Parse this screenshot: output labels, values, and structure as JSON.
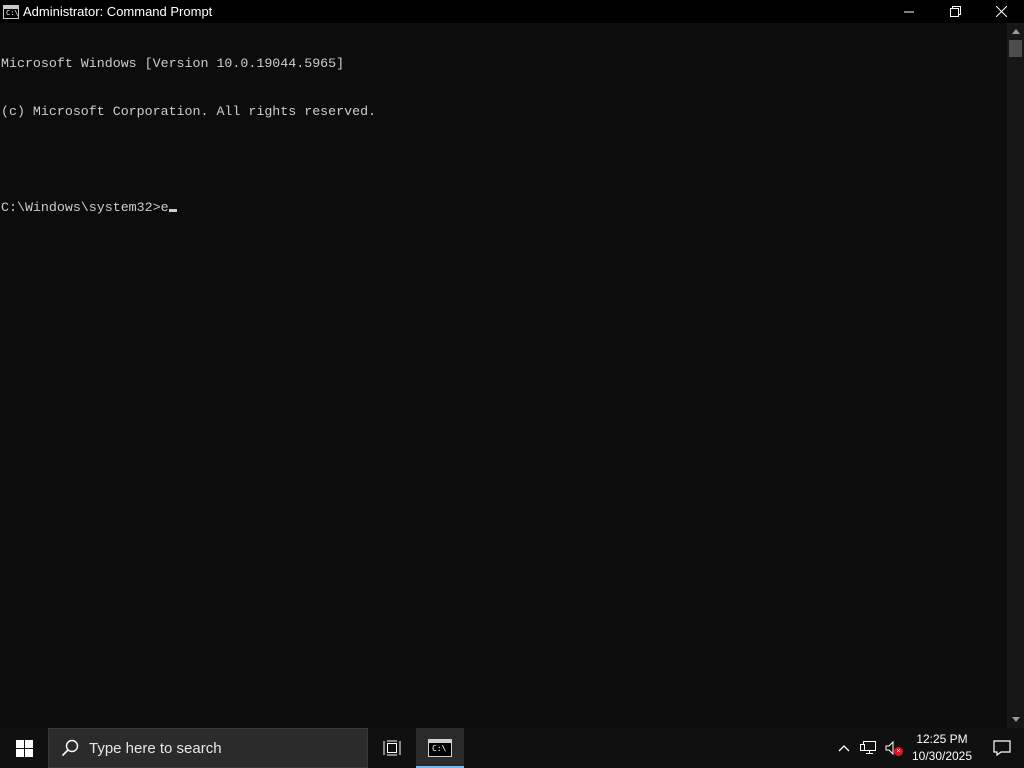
{
  "window": {
    "title": "Administrator: Command Prompt",
    "icon_text": "C:\\",
    "controls": [
      "minimize-icon",
      "restore-icon",
      "close-icon"
    ]
  },
  "console": {
    "lines": [
      "Microsoft Windows [Version 10.0.19044.5965]",
      "(c) Microsoft Corporation. All rights reserved.",
      "",
      "C:\\Windows\\system32>e"
    ],
    "colors": {
      "background": "#0c0c0c",
      "text": "#cccccc"
    }
  },
  "taskbar": {
    "search_placeholder": "Type here to search",
    "cmd_icon_text": "C:\\",
    "clock": {
      "time": "12:25 PM",
      "date": "10/30/2025"
    },
    "accent": "#76b9ed",
    "tray_icons": [
      "chevron-up-icon",
      "network-icon",
      "volume-muted-icon",
      "notification-icon"
    ]
  }
}
